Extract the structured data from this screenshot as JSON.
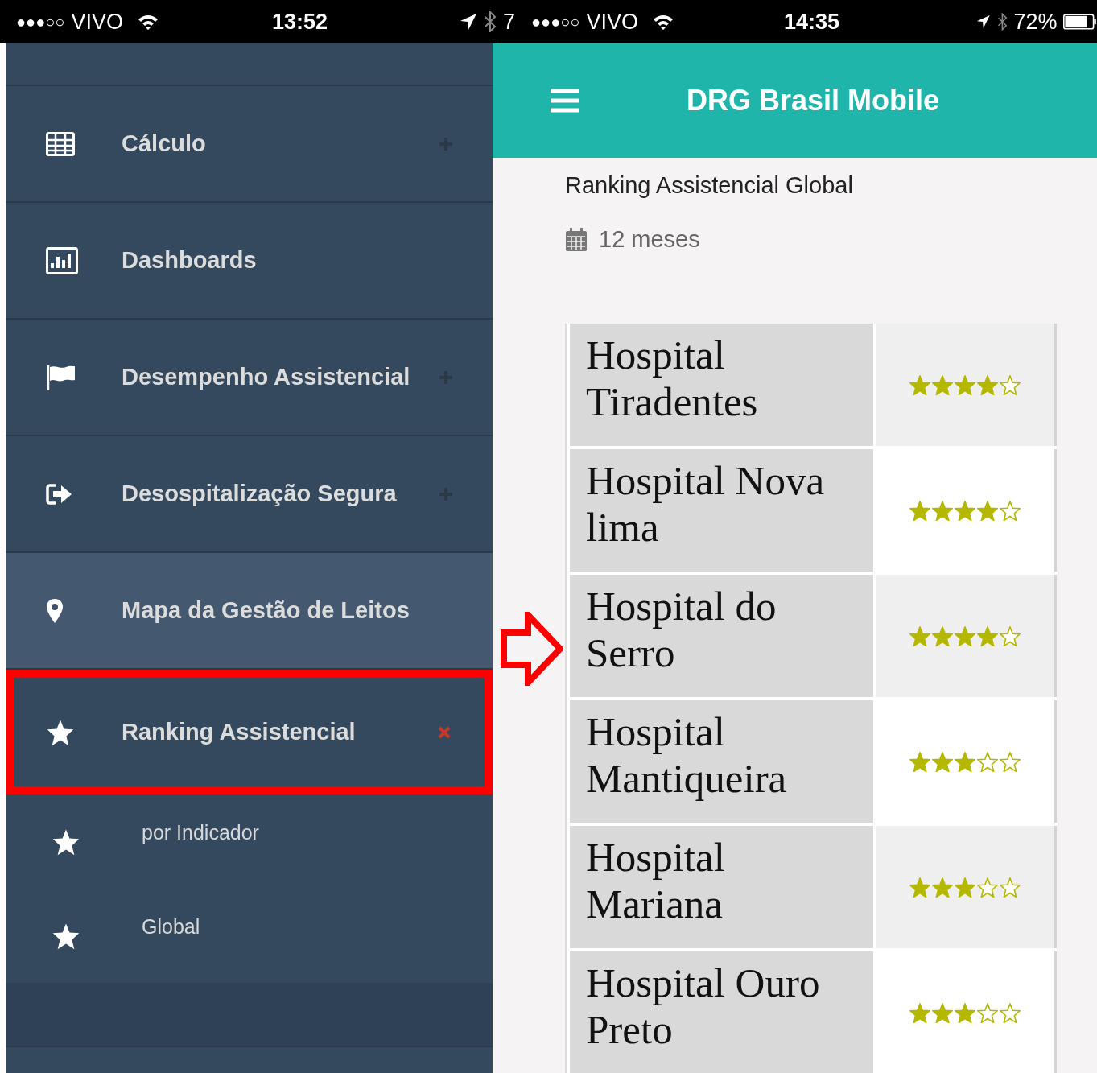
{
  "status_bars": [
    {
      "signal": "●●●○○",
      "carrier": "VIVO",
      "time": "13:52",
      "battery": "7"
    },
    {
      "signal": "●●●○○",
      "carrier": "VIVO",
      "time": "14:35",
      "battery": "72%"
    }
  ],
  "sidebar": {
    "items": [
      {
        "label": "Cálculo",
        "expandable": true,
        "expanded": false,
        "selected": false,
        "annotated": false
      },
      {
        "label": "Dashboards",
        "expandable": false,
        "selected": false,
        "annotated": false
      },
      {
        "label": "Desempenho Assistencial",
        "expandable": true,
        "expanded": false,
        "selected": false,
        "annotated": false
      },
      {
        "label": "Desospitalização Segura",
        "expandable": true,
        "expanded": false,
        "selected": false,
        "annotated": false
      },
      {
        "label": "Mapa da Gestão de Leitos",
        "expandable": false,
        "selected": true,
        "annotated": false
      },
      {
        "label": "Ranking Assistencial",
        "expandable": true,
        "expanded": true,
        "selected": false,
        "annotated": true,
        "children": [
          {
            "label": "por Indicador"
          },
          {
            "label": "Global"
          }
        ]
      }
    ]
  },
  "app": {
    "title": "DRG Brasil Mobile",
    "page_title": "Ranking Assistencial Global",
    "period": "12 meses",
    "ranking": [
      {
        "name": "Hospital Tiradentes",
        "stars": 4
      },
      {
        "name": "Hospital Nova lima",
        "stars": 4
      },
      {
        "name": "Hospital do Serro",
        "stars": 4
      },
      {
        "name": "Hospital Mantiqueira",
        "stars": 3
      },
      {
        "name": "Hospital Mariana",
        "stars": 3
      },
      {
        "name": "Hospital Ouro Preto",
        "stars": 3
      }
    ]
  }
}
